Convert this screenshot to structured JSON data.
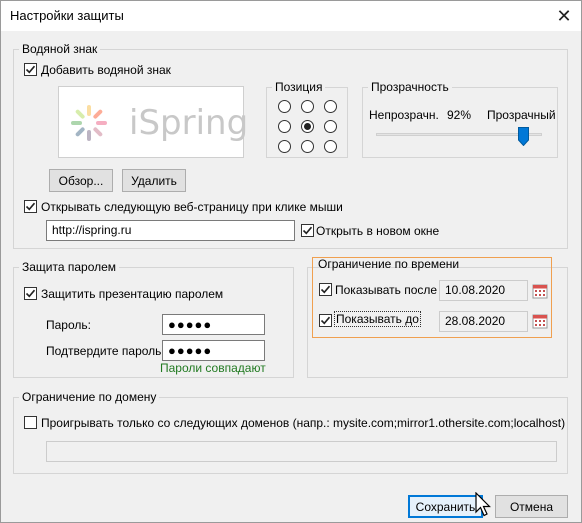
{
  "window": {
    "title": "Настройки защиты",
    "close_glyph": "✕"
  },
  "watermark": {
    "legend": "Водяной знак",
    "add_label": "Добавить водяной знак",
    "add_checked": true,
    "preview_text": "iSpring",
    "browse_label": "Обзор...",
    "delete_label": "Удалить",
    "open_url_label": "Открывать следующую веб-страницу при клике мыши",
    "open_url_checked": true,
    "url_value": "http://ispring.ru",
    "new_window_label": "Открыть в новом окне",
    "new_window_checked": true
  },
  "position": {
    "legend": "Позиция",
    "selected_index": 4
  },
  "transparency": {
    "legend": "Прозрачность",
    "opaque_label": "Непрозрачн.",
    "value_label": "92%",
    "transparent_label": "Прозрачный",
    "value_fraction": 0.92
  },
  "password": {
    "legend": "Защита паролем",
    "protect_label": "Защитить презентацию паролем",
    "protect_checked": true,
    "password_label": "Пароль:",
    "password_value": "●●●●●",
    "confirm_label": "Подтвердите пароль:",
    "confirm_value": "●●●●●",
    "match_status": "Пароли совпадают"
  },
  "time": {
    "legend": "Ограничение по времени",
    "after_label": "Показывать после",
    "after_checked": true,
    "after_date": "10.08.2020",
    "before_label": "Показывать до",
    "before_checked": true,
    "before_date": "28.08.2020"
  },
  "domain": {
    "legend": "Ограничение по домену",
    "only_label": "Проигрывать только со следующих доменов (напр.: mysite.com;mirror1.othersite.com;localhost)",
    "only_checked": false,
    "domains_value": ""
  },
  "footer": {
    "save_label": "Сохранить",
    "cancel_label": "Отмена"
  },
  "colors": {
    "accent": "#0078d7",
    "highlight_border": "#f0a050",
    "status_green": "#217a21"
  },
  "icons": [
    "close-icon",
    "check-icon",
    "calendar-icon",
    "mouse-cursor-icon",
    "slider-thumb-icon"
  ]
}
